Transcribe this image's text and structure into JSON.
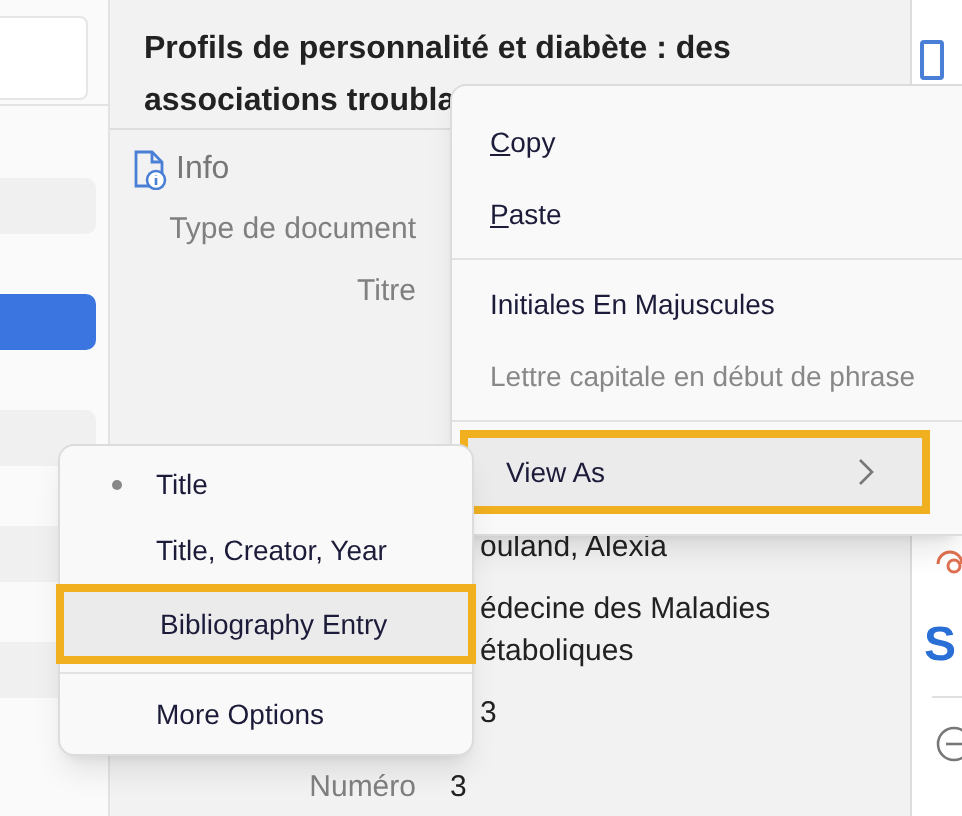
{
  "sidebar": {
    "items": [
      {
        "selected": false
      },
      {
        "selected": true
      },
      {
        "selected": false
      },
      {
        "selected": false
      },
      {
        "selected": false
      }
    ]
  },
  "item_pane": {
    "title": "Profils de personnalité et diabète : des associations troubla",
    "section": "Info",
    "fields": [
      {
        "label": "Type de document"
      },
      {
        "label": "Titre"
      },
      {
        "value": "ouland, Alexia"
      },
      {
        "value": "édecine des Maladies étaboliques"
      },
      {
        "value": "3"
      },
      {
        "label": "Numéro",
        "value": "3"
      }
    ]
  },
  "right_pane": {
    "heading": "S"
  },
  "context_menu": {
    "groups": [
      [
        {
          "label": "Copy",
          "underline_first": true,
          "disabled": false
        },
        {
          "label": "Paste",
          "underline_first": true,
          "disabled": false
        }
      ],
      [
        {
          "label": "Initiales En Majuscules",
          "underline_first": false,
          "disabled": false
        },
        {
          "label": "Lettre capitale en début de phrase",
          "underline_first": false,
          "disabled": true
        }
      ],
      [
        {
          "label": "View As",
          "underline_first": false,
          "disabled": false,
          "submenu": true,
          "highlighted": true
        }
      ]
    ]
  },
  "submenu": {
    "groups": [
      [
        {
          "label": "Title",
          "selected": true,
          "highlighted": false
        },
        {
          "label": "Title, Creator, Year",
          "selected": false,
          "highlighted": false
        },
        {
          "label": "Bibliography Entry",
          "selected": false,
          "highlighted": true
        }
      ],
      [
        {
          "label": "More Options",
          "selected": false,
          "highlighted": false
        }
      ]
    ]
  }
}
